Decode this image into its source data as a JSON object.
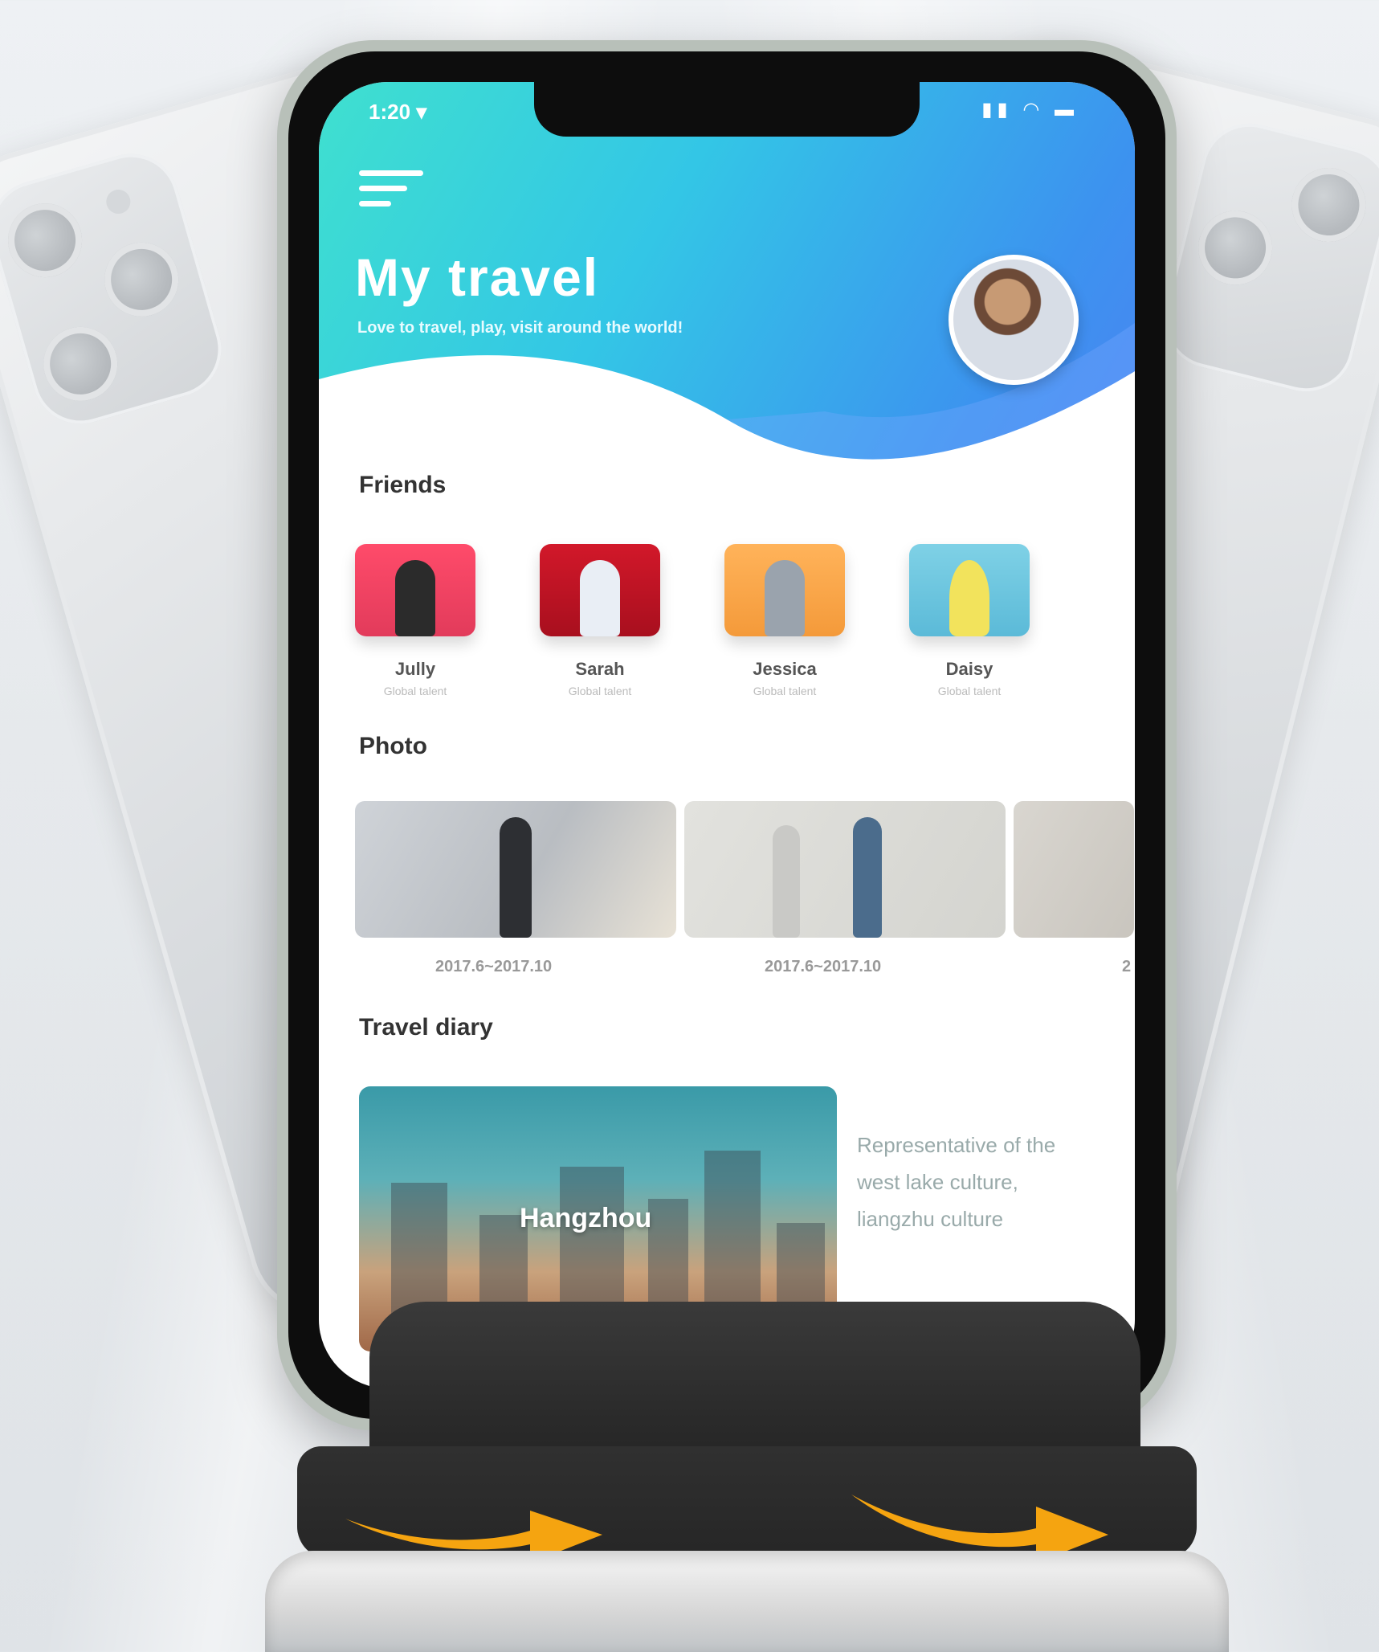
{
  "status_bar": {
    "time": "1:20 ▾",
    "icons": "▮▮ ◠ ▬"
  },
  "header": {
    "title": "My travel",
    "subtitle": "Love to travel, play, visit around the world!"
  },
  "sections": {
    "friends": "Friends",
    "photo": "Photo",
    "diary": "Travel diary"
  },
  "friends": [
    {
      "name": "Jully",
      "sub": "Global talent"
    },
    {
      "name": "Sarah",
      "sub": "Global talent"
    },
    {
      "name": "Jessica",
      "sub": "Global talent"
    },
    {
      "name": "Daisy",
      "sub": "Global talent"
    }
  ],
  "photos": [
    {
      "date": "2017.6~2017.10"
    },
    {
      "date": "2017.6~2017.10"
    },
    {
      "date": "2"
    }
  ],
  "diary": {
    "label": "Hangzhou",
    "text": "Representative of the west lake culture, liangzhu culture"
  },
  "colors": {
    "accent": "#3cb8ea",
    "arrow": "#f5a410",
    "stand": "#2b2b2b"
  },
  "icons": [
    "menu-icon",
    "avatar",
    "rotate-arrow-icon"
  ]
}
